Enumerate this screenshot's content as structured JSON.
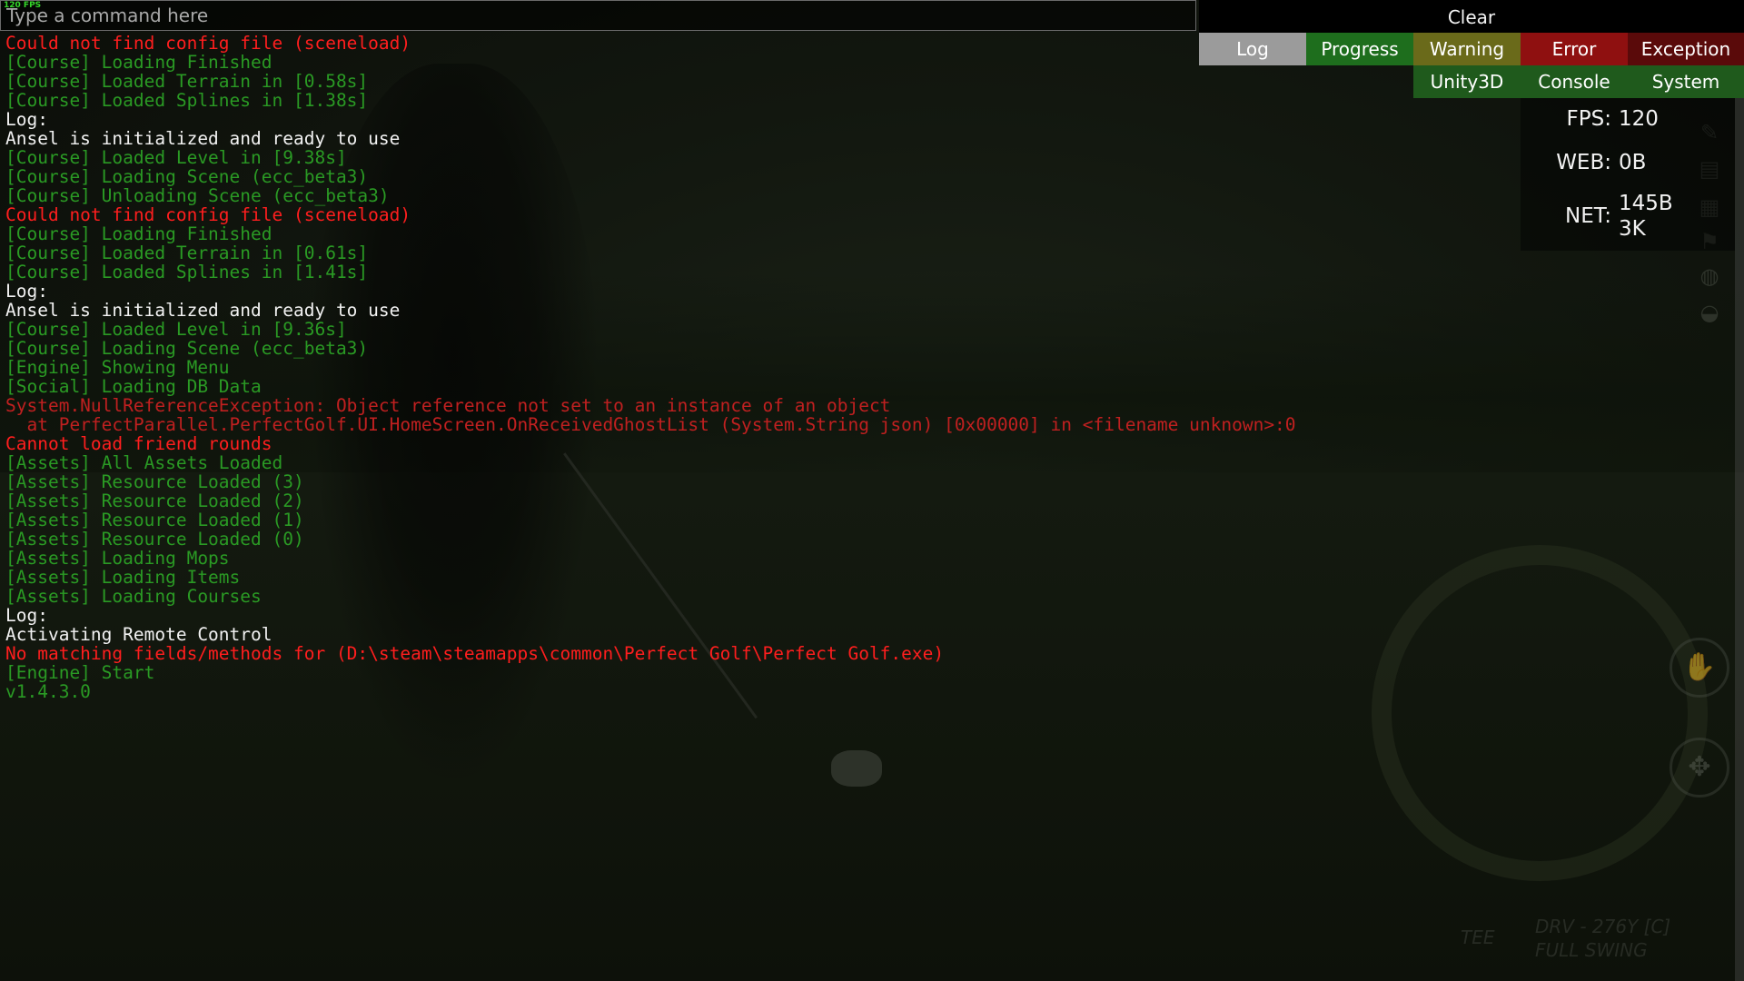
{
  "overlay": {
    "fps_tiny": "120 FPS"
  },
  "command_bar": {
    "placeholder": "Type a command here"
  },
  "filters": {
    "clear": "Clear",
    "log": "Log",
    "progress": "Progress",
    "warning": "Warning",
    "error": "Error",
    "exception": "Exception",
    "unity3d": "Unity3D",
    "console": "Console",
    "system": "System"
  },
  "stats": {
    "fps_label": "FPS:",
    "fps_value": "120",
    "web_label": "WEB:",
    "web_value": "0B",
    "net_label": "NET:",
    "net_value_1": "145B",
    "net_value_2": "3K"
  },
  "hud": {
    "tee": "TEE",
    "club_line": "DRV - 276Y [C]",
    "swing_line": "FULL SWING"
  },
  "log": [
    {
      "text": "Could not find config file (sceneload)",
      "kind": "error"
    },
    {
      "text": "[Course] Loading Finished",
      "kind": "course"
    },
    {
      "text": "[Course] Loaded Terrain in [0.58s]",
      "kind": "course"
    },
    {
      "text": "[Course] Loaded Splines in [1.38s]",
      "kind": "course"
    },
    {
      "text": "Log:",
      "kind": "white"
    },
    {
      "text": "Ansel is initialized and ready to use",
      "kind": "white"
    },
    {
      "text": "[Course] Loaded Level in [9.38s]",
      "kind": "course"
    },
    {
      "text": "[Course] Loading Scene (ecc_beta3)",
      "kind": "course"
    },
    {
      "text": "[Course] Unloading Scene (ecc_beta3)",
      "kind": "course"
    },
    {
      "text": "Could not find config file (sceneload)",
      "kind": "error"
    },
    {
      "text": "[Course] Loading Finished",
      "kind": "course"
    },
    {
      "text": "[Course] Loaded Terrain in [0.61s]",
      "kind": "course"
    },
    {
      "text": "[Course] Loaded Splines in [1.41s]",
      "kind": "course"
    },
    {
      "text": "Log:",
      "kind": "white"
    },
    {
      "text": "Ansel is initialized and ready to use",
      "kind": "white"
    },
    {
      "text": "[Course] Loaded Level in [9.36s]",
      "kind": "course"
    },
    {
      "text": "[Course] Loading Scene (ecc_beta3)",
      "kind": "course"
    },
    {
      "text": "[Engine] Showing Menu",
      "kind": "course"
    },
    {
      "text": "[Social] Loading DB Data",
      "kind": "course"
    },
    {
      "text": "System.NullReferenceException: Object reference not set to an instance of an object",
      "kind": "exception"
    },
    {
      "text": "  at PerfectParallel.PerfectGolf.UI.HomeScreen.OnReceivedGhostList (System.String json) [0x00000] in <filename unknown>:0",
      "kind": "exception"
    },
    {
      "text": "Cannot load friend rounds",
      "kind": "error"
    },
    {
      "text": "[Assets] All Assets Loaded",
      "kind": "course"
    },
    {
      "text": "[Assets] Resource Loaded (3)",
      "kind": "course"
    },
    {
      "text": "[Assets] Resource Loaded (2)",
      "kind": "course"
    },
    {
      "text": "[Assets] Resource Loaded (1)",
      "kind": "course"
    },
    {
      "text": "[Assets] Resource Loaded (0)",
      "kind": "course"
    },
    {
      "text": "[Assets] Loading Mops",
      "kind": "course"
    },
    {
      "text": "[Assets] Loading Items",
      "kind": "course"
    },
    {
      "text": "[Assets] Loading Courses",
      "kind": "course"
    },
    {
      "text": "Log:",
      "kind": "white"
    },
    {
      "text": "Activating Remote Control",
      "kind": "white"
    },
    {
      "text": "No matching fields/methods for (D:\\steam\\steamapps\\common\\Perfect Golf\\Perfect Golf.exe)",
      "kind": "error"
    },
    {
      "text": "[Engine] Start",
      "kind": "course"
    },
    {
      "text": "v1.4.3.0",
      "kind": "course"
    }
  ]
}
